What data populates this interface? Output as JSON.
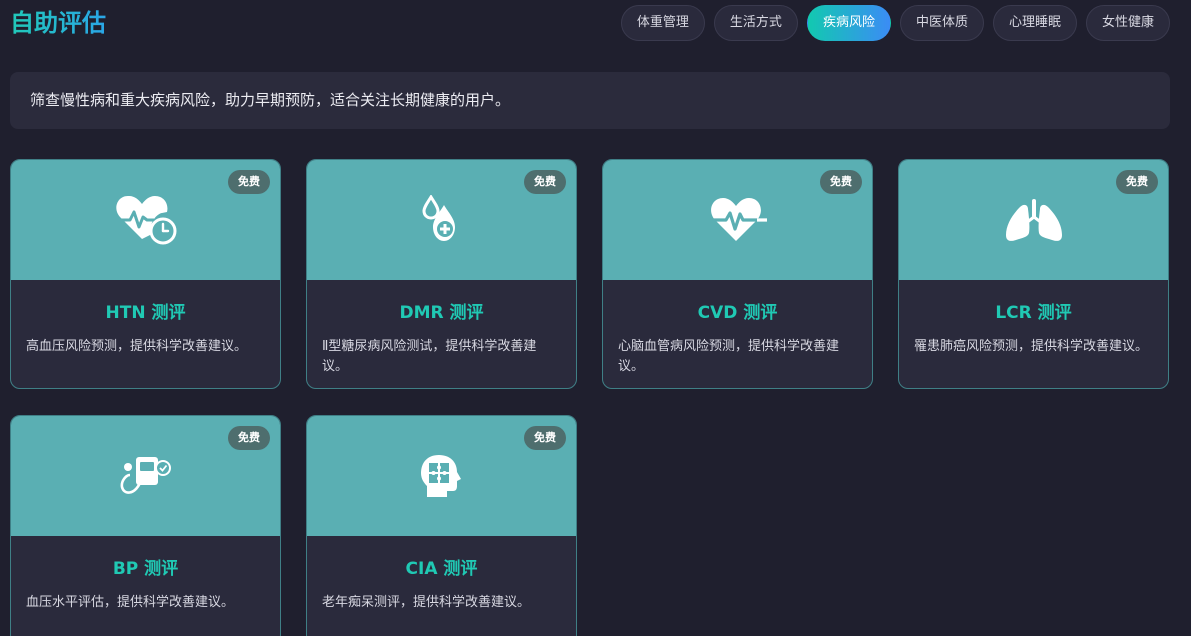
{
  "header": {
    "title": "自助评估"
  },
  "tabs": [
    {
      "label": "体重管理"
    },
    {
      "label": "生活方式"
    },
    {
      "label": "疾病风险"
    },
    {
      "label": "中医体质"
    },
    {
      "label": "心理睡眠"
    },
    {
      "label": "女性健康"
    }
  ],
  "active_tab": "疾病风险",
  "description": "筛查慢性病和重大疾病风险，助力早期预防，适合关注长期健康的用户。",
  "colors": {
    "accent": "#20c9b4",
    "banner": "#5aafb3",
    "background": "#1f1f2e"
  },
  "cards": [
    {
      "title": "HTN 测评",
      "desc": "高血压风险预测，提供科学改善建议。",
      "badge": "免费",
      "icon": "heart-clock-icon"
    },
    {
      "title": "DMR 测评",
      "desc": "Ⅱ型糖尿病风险测试，提供科学改善建议。",
      "badge": "免费",
      "icon": "blood-drop-icon"
    },
    {
      "title": "CVD 测评",
      "desc": "心脑血管病风险预测，提供科学改善建议。",
      "badge": "免费",
      "icon": "heart-pulse-icon"
    },
    {
      "title": "LCR 测评",
      "desc": "罹患肺癌风险预测，提供科学改善建议。",
      "badge": "免费",
      "icon": "lungs-icon"
    },
    {
      "title": "BP 测评",
      "desc": "血压水平评估，提供科学改善建议。",
      "badge": "免费",
      "icon": "blood-pressure-monitor-icon"
    },
    {
      "title": "CIA 测评",
      "desc": "老年痴呆测评，提供科学改善建议。",
      "badge": "免费",
      "icon": "brain-puzzle-icon"
    }
  ]
}
